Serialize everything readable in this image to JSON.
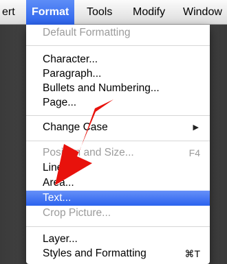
{
  "menubar": {
    "items": [
      {
        "label": "ert"
      },
      {
        "label": "Format"
      },
      {
        "label": "Tools"
      },
      {
        "label": "Modify"
      },
      {
        "label": "Window"
      }
    ]
  },
  "menu": {
    "default_formatting": "Default Formatting",
    "character": "Character...",
    "paragraph": "Paragraph...",
    "bullets": "Bullets and Numbering...",
    "page": "Page...",
    "change_case": "Change Case",
    "position_size": "Position and Size...",
    "position_size_shortcut": "F4",
    "line": "Line...",
    "area": "Area...",
    "text": "Text...",
    "crop_picture": "Crop Picture...",
    "layer": "Layer...",
    "styles": "Styles and Formatting",
    "styles_shortcut": "⌘T",
    "submenu_arrow": "▶"
  },
  "colors": {
    "highlight": "#2b63ee",
    "annotation_arrow": "#e8120c"
  }
}
